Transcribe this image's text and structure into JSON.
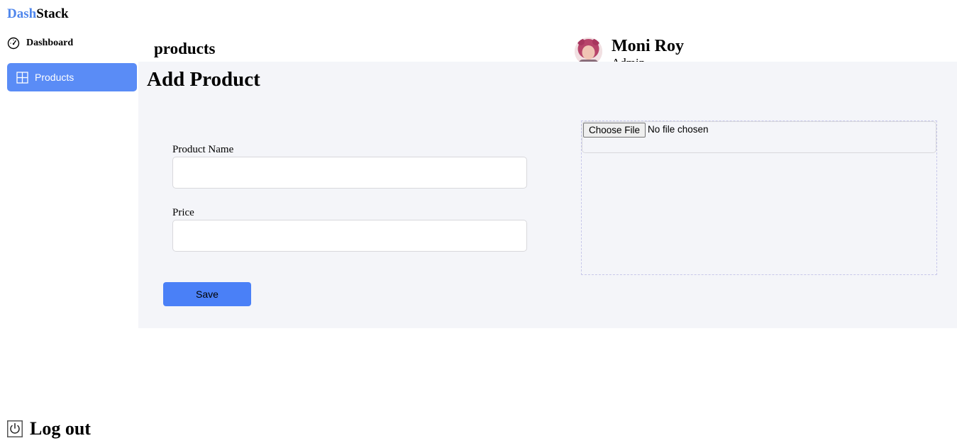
{
  "brand": {
    "part1": "Dash",
    "part2": "Stack",
    "accent_color": "#4f86ec"
  },
  "sidebar": {
    "items": [
      {
        "label": "Dashboard",
        "icon": "speedometer-icon",
        "active": false
      },
      {
        "label": "Products",
        "icon": "grid-icon",
        "active": true
      }
    ],
    "active_color": "#5a8cf6"
  },
  "header": {
    "page_title": "products",
    "user": {
      "name": "Moni Roy",
      "role": "Admin"
    }
  },
  "form": {
    "title": "Add Product",
    "fields": [
      {
        "label": "Product Name",
        "value": ""
      },
      {
        "label": "Price",
        "value": ""
      }
    ],
    "file_button_label": "Choose File",
    "file_status": "No file chosen",
    "save_label": "Save",
    "save_color": "#4a80f7"
  },
  "logout": {
    "label": "Log out",
    "icon": "power-icon"
  }
}
